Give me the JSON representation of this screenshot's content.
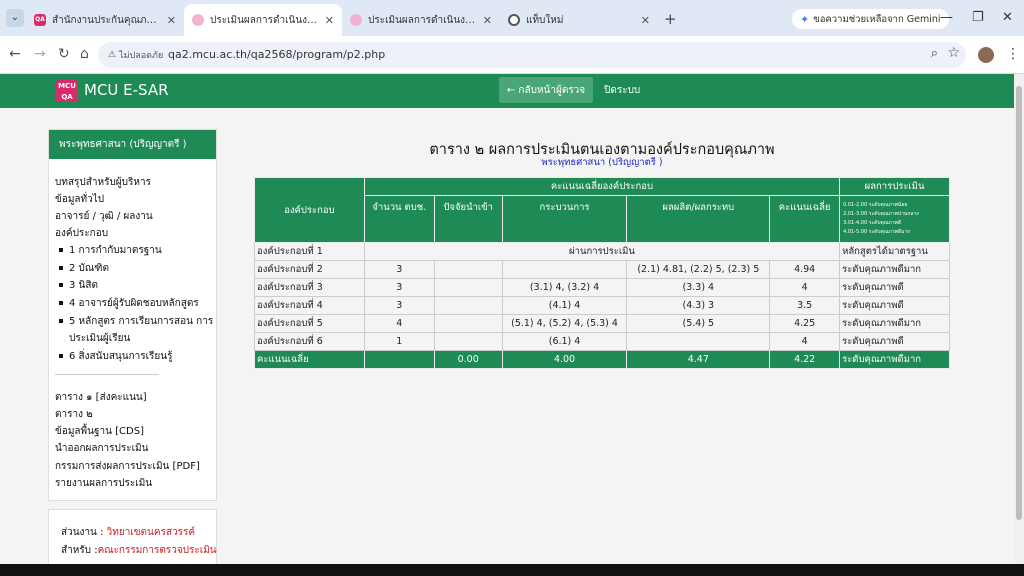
{
  "browser": {
    "tabs": [
      {
        "title": "สำนักงานประกันคุณภาพ - มหาวิทยาลัย",
        "fav_text": "QA",
        "fav_color": "#d92b6a"
      },
      {
        "title": "ประเมินผลการดำเนินงาน วิทยาเขตนครสวรรค์",
        "fav_text": "",
        "fav_color": "#f2b3d0"
      },
      {
        "title": "ประเมินผลการดำเนินงาน วิทยาลัยสงฆ์",
        "fav_text": "",
        "fav_color": "#f2b3d0"
      },
      {
        "title": "แท็บใหม่",
        "fav_text": "",
        "fav_color": "#555555"
      }
    ],
    "gemini_label": "ขอความช่วยเหลือจาก Gemini",
    "security_label": "ไม่ปลอดภัย",
    "url": "qa2.mcu.ac.th/qa2568/program/p2.php"
  },
  "app": {
    "logo_text": "MCU QA",
    "brand": "MCU E-SAR",
    "back_button": "← กลับหน้าผู้ตรวจ",
    "close_button": "ปิดระบบ"
  },
  "sidebar": {
    "header": "พระพุทธศาสนา (ปริญญาตรี )",
    "top_links": [
      "บทสรุปสำหรับผู้บริหาร",
      "ข้อมูลทั่วไป",
      "อาจารย์ / วุฒิ / ผลงาน",
      "องค์ประกอบ"
    ],
    "sub_items": [
      "1 การกำกับมาตรฐาน",
      "2 บัณฑิต",
      "3 นิสิต",
      "4 อาจารย์ผู้รับผิดชอบหลักสูตร",
      "5 หลักสูตร การเรียนการสอน การ",
      "ประเมินผู้เรียน",
      "6 สิ่งสนับสนุนการเรียนรู้"
    ],
    "bottom_links": [
      "ตาราง ๑ [ส่งคะแนน]",
      "ตาราง ๒",
      "ข้อมูลพื้นฐาน [CDS]",
      "นำออกผลการประเมิน",
      "กรรมการส่งผลการประเมิน [PDF]",
      "รายงานผลการประเมิน"
    ]
  },
  "info": {
    "unit_label": "ส่วนงาน : ",
    "unit_value": "วิทยาเขตนครสวรรค์",
    "for_label": "สำหรับ :",
    "for_value": "คณะกรรมการตรวจประเมิน"
  },
  "main": {
    "title": "ตาราง ๒ ผลการประเมินตนเองตามองค์ประกอบคุณภาพ",
    "subtitle": "พระพุทธศาสนา (ปริญญาตรี )",
    "table": {
      "h_component": "องค์ประกอบ",
      "h_avg_group": "คะแนนเฉลี่ยองค์ประกอบ",
      "h_result": "ผลการประเมิน",
      "h_count": "จำนวน ตบช.",
      "h_input": "ปัจจัยนำเข้า",
      "h_process": "กระบวนการ",
      "h_output": "ผลผลิต/ผลกระทบ",
      "h_avg": "คะแนนเฉลี่ย",
      "legend": [
        "0.01-2.00 ระดับคุณภาพน้อย",
        "2.01-3.00 ระดับคุณภาพปานกลาง",
        "3.01-4.00 ระดับคุณภาพดี",
        "4.01-5.00 ระดับคุณภาพดีมาก"
      ],
      "row1": {
        "name": "องค์ประกอบที่ 1",
        "merged": "ผ่านการประเมิน",
        "result": "หลักสูตรได้มาตรฐาน"
      },
      "rows": [
        {
          "name": "องค์ประกอบที่ 2",
          "count": "3",
          "input": "",
          "process": "",
          "output": "(2.1) 4.81, (2.2) 5, (2.3) 5",
          "avg": "4.94",
          "result": "ระดับคุณภาพดีมาก"
        },
        {
          "name": "องค์ประกอบที่ 3",
          "count": "3",
          "input": "",
          "process": "(3.1) 4, (3.2) 4",
          "output": "(3.3) 4",
          "avg": "4",
          "result": "ระดับคุณภาพดี"
        },
        {
          "name": "องค์ประกอบที่ 4",
          "count": "3",
          "input": "",
          "process": "(4.1) 4",
          "output": "(4.3) 3",
          "avg": "3.5",
          "result": "ระดับคุณภาพดี"
        },
        {
          "name": "องค์ประกอบที่ 5",
          "count": "4",
          "input": "",
          "process": "(5.1) 4, (5.2) 4, (5.3) 4",
          "output": "(5.4) 5",
          "avg": "4.25",
          "result": "ระดับคุณภาพดีมาก"
        },
        {
          "name": "องค์ประกอบที่ 6",
          "count": "1",
          "input": "",
          "process": "(6.1) 4",
          "output": "",
          "avg": "4",
          "result": "ระดับคุณภาพดี"
        }
      ],
      "avg_row": {
        "label": "คะแนนเฉลี่ย",
        "input": "0.00",
        "process": "4.00",
        "output": "4.47",
        "avg": "4.22",
        "result": "ระดับคุณภาพดีมาก"
      }
    }
  }
}
